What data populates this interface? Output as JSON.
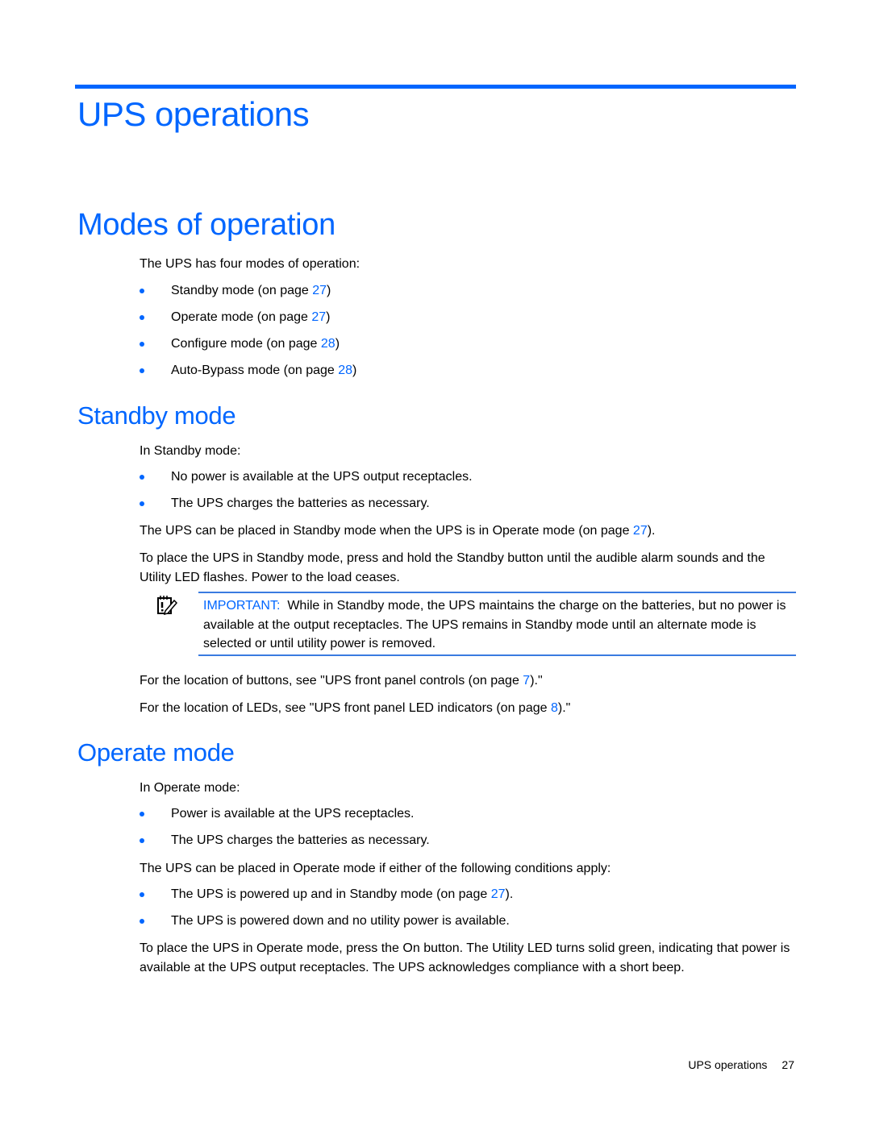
{
  "chapter": {
    "title": "UPS operations"
  },
  "sections": {
    "modes": {
      "heading": "Modes of operation",
      "intro": "The UPS has four modes of operation:",
      "items": [
        {
          "text": "Standby mode (on page ",
          "page": "27",
          "after": ")"
        },
        {
          "text": "Operate mode (on page ",
          "page": "27",
          "after": ")"
        },
        {
          "text": "Configure mode (on page ",
          "page": "28",
          "after": ")"
        },
        {
          "text": "Auto-Bypass mode (on page ",
          "page": "28",
          "after": ")"
        }
      ]
    },
    "standby": {
      "heading": "Standby mode",
      "intro": "In Standby mode:",
      "items": [
        "No power is available at the UPS output receptacles.",
        "The UPS charges the batteries as necessary."
      ],
      "para1": {
        "text": "The UPS can be placed in Standby mode when the UPS is in Operate mode (on page ",
        "page": "27",
        "after": ")."
      },
      "para2": "To place the UPS in Standby mode, press and hold the Standby button until the audible alarm sounds and the Utility LED flashes. Power to the load ceases.",
      "note": {
        "icon": "important-notepad-icon",
        "label": "IMPORTANT:",
        "text": "While in Standby mode, the UPS maintains the charge on the batteries, but no power is available at the output receptacles. The UPS remains in Standby mode until an alternate mode is selected or until utility power is removed."
      },
      "ref_buttons": {
        "text": "For the location of buttons, see \"UPS front panel controls (on page ",
        "page": "7",
        "after": ").\""
      },
      "ref_leds": {
        "text": "For the location of LEDs, see \"UPS front panel LED indicators (on page ",
        "page": "8",
        "after": ").\""
      }
    },
    "operate": {
      "heading": "Operate mode",
      "intro": "In Operate mode:",
      "items": [
        "Power is available at the UPS receptacles.",
        "The UPS charges the batteries as necessary."
      ],
      "para1": "The UPS can be placed in Operate mode if either of the following conditions apply:",
      "conditions": [
        {
          "text": "The UPS is powered up and in Standby mode (on page ",
          "page": "27",
          "after": ")."
        },
        {
          "text": "The UPS is powered down and no utility power is available.",
          "page": null,
          "after": ""
        }
      ],
      "para2": "To place the UPS in Operate mode, press the On button. The Utility LED turns solid green, indicating that power is available at the UPS output receptacles. The UPS acknowledges compliance with a short beep."
    }
  },
  "footer": {
    "section": "UPS operations",
    "page": "27"
  },
  "colors": {
    "accent": "#0066ff",
    "text": "#000000"
  }
}
